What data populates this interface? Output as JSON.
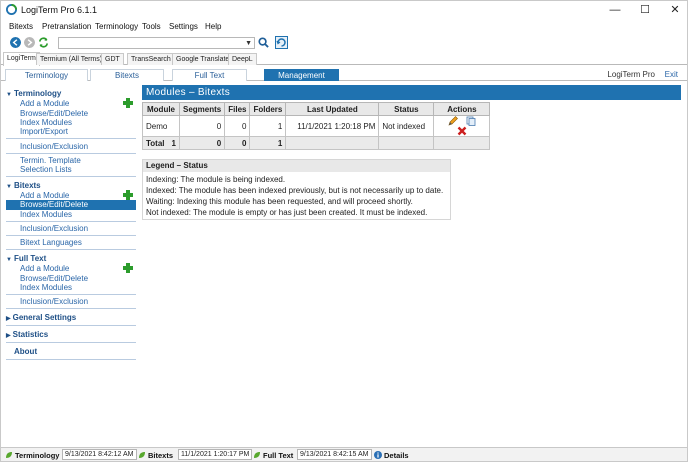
{
  "window": {
    "title": "LogiTerm Pro 6.1.1"
  },
  "menu": [
    "Bitexts",
    "Pretranslation",
    "Terminology",
    "Tools",
    "Settings",
    "Help"
  ],
  "service_tabs": [
    "LogiTerm",
    "Termium (All Terms)",
    "GDT",
    "TransSearch",
    "Google Translate",
    "DeepL"
  ],
  "main_tabs": [
    "Terminology",
    "Bitexts",
    "Full Text",
    "Management"
  ],
  "header_right": {
    "brand": "LogiTerm Pro",
    "exit": "Exit"
  },
  "sidebar": {
    "terminology": {
      "title": "Terminology",
      "items": [
        "Add a Module",
        "Browse/Edit/Delete",
        "Index Modules",
        "Import/Export",
        "Inclusion/Exclusion",
        "Termin. Template",
        "Selection Lists"
      ]
    },
    "bitexts": {
      "title": "Bitexts",
      "items": [
        "Add a Module",
        "Browse/Edit/Delete",
        "Index Modules",
        "Inclusion/Exclusion",
        "Bitext Languages"
      ]
    },
    "fulltext": {
      "title": "Full Text",
      "items": [
        "Add a Module",
        "Browse/Edit/Delete",
        "Index Modules",
        "Inclusion/Exclusion"
      ]
    },
    "general": "General Settings",
    "statistics": "Statistics",
    "about": "About"
  },
  "panel": {
    "title": "Modules – Bitexts"
  },
  "table": {
    "headers": [
      "Module",
      "Segments",
      "Files",
      "Folders",
      "Last Updated",
      "Status",
      "Actions"
    ],
    "rows": [
      {
        "module": "Demo",
        "segments": "0",
        "files": "0",
        "folders": "1",
        "updated": "11/1/2021 1:20:18 PM",
        "status": "Not indexed"
      }
    ],
    "total": {
      "label": "Total",
      "count": "1",
      "segments": "0",
      "files": "0",
      "folders": "1"
    }
  },
  "legend": {
    "title": "Legend – Status",
    "lines": [
      "Indexing: The module is being indexed.",
      "Indexed: The module has been indexed previously, but is not necessarily up to date.",
      "Waiting: Indexing this module has been requested, and will proceed shortly.",
      "Not indexed: The module is empty or has just been created. It must be indexed."
    ]
  },
  "statusbar": {
    "terminology": "Terminology",
    "terminology_time": "9/13/2021 8:42:12 AM",
    "bitexts": "Bitexts",
    "bitexts_time": "11/1/2021 1:20:17 PM",
    "fulltext": "Full Text",
    "fulltext_time": "9/13/2021 8:42:15 AM",
    "details": "Details"
  },
  "colors": {
    "accent": "#1f72b0",
    "link": "#2a66a8",
    "add": "#2c9c2c",
    "delete": "#cc1f1f"
  }
}
